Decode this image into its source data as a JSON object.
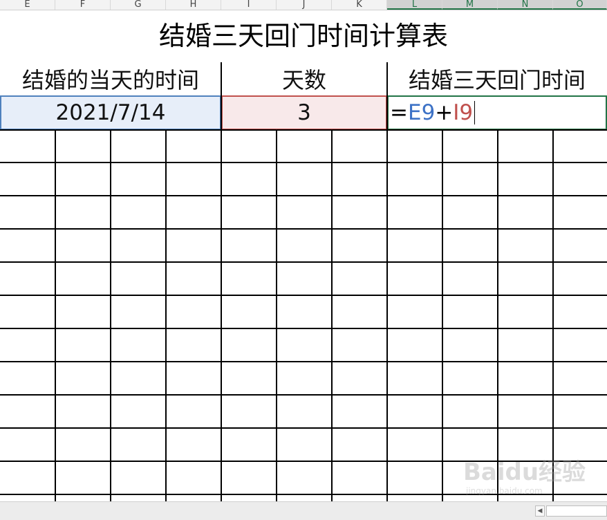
{
  "columns": [
    "E",
    "F",
    "G",
    "H",
    "I",
    "J",
    "K",
    "L",
    "M",
    "N",
    "O"
  ],
  "selected_columns": [
    "L",
    "M",
    "N",
    "O"
  ],
  "sheet": {
    "title": "结婚三天回门时间计算表",
    "headers": {
      "wedding_date": "结婚的当天的时间",
      "days": "天数",
      "return_date": "结婚三天回门时间"
    },
    "values": {
      "wedding_date": "2021/7/14",
      "days": "3"
    },
    "formula": {
      "eq": "=",
      "ref1": "E9",
      "op": "+",
      "ref2": "I9"
    }
  },
  "colors": {
    "ref1": "#3d72c6",
    "ref2": "#c0504d",
    "active_border": "#217346"
  },
  "watermark": {
    "brand": "Baidu经验",
    "sub": "jingyan.baidu.com"
  }
}
